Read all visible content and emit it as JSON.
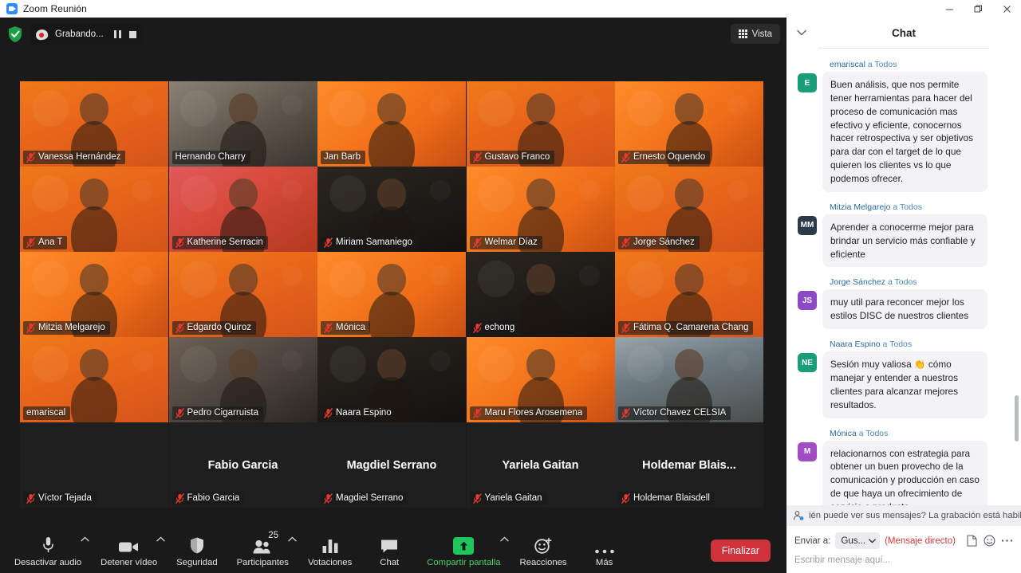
{
  "window": {
    "title": "Zoom Reunión",
    "logo_icon": "zoom-logo-icon",
    "minimize_icon": "minimize-icon",
    "maximize_icon": "restore-icon",
    "close_icon": "close-icon"
  },
  "recording": {
    "shield_icon": "security-shield-icon",
    "rec_icon": "recording-dot-icon",
    "label": "Grabando...",
    "pause_icon": "pause-icon",
    "stop_icon": "stop-icon"
  },
  "view_button": {
    "label": "Vista",
    "icon": "grid-view-icon"
  },
  "gallery": {
    "rows": [
      [
        {
          "name": "Vanessa Hernández",
          "muted": true,
          "speaking": false,
          "bg": "bg-orange",
          "kind": "video"
        },
        {
          "name": "Hernando Charry",
          "muted": false,
          "speaking": true,
          "bg": "bg-room",
          "kind": "video"
        },
        {
          "name": "Jan Barb",
          "muted": false,
          "speaking": false,
          "bg": "bg-orange2",
          "kind": "video"
        },
        {
          "name": "Gustavo Franco",
          "muted": true,
          "speaking": false,
          "bg": "bg-orange",
          "kind": "video"
        },
        {
          "name": "Ernesto Oquendo",
          "muted": true,
          "speaking": false,
          "bg": "bg-orange2",
          "kind": "video"
        }
      ],
      [
        {
          "name": "Ana T",
          "muted": true,
          "speaking": false,
          "bg": "bg-orange",
          "kind": "video"
        },
        {
          "name": "Katherine Serracin",
          "muted": true,
          "speaking": false,
          "bg": "bg-pinkish",
          "kind": "video"
        },
        {
          "name": "Miriam Samaniego",
          "muted": true,
          "speaking": false,
          "bg": "bg-dark",
          "kind": "video"
        },
        {
          "name": "Welmar Díaz",
          "muted": true,
          "speaking": false,
          "bg": "bg-orange2",
          "kind": "video"
        },
        {
          "name": "Jorge Sánchez",
          "muted": true,
          "speaking": false,
          "bg": "bg-orange",
          "kind": "video"
        }
      ],
      [
        {
          "name": "Mitzia Melgarejo",
          "muted": true,
          "speaking": false,
          "bg": "bg-orange2",
          "kind": "video"
        },
        {
          "name": "Edgardo Quiroz",
          "muted": true,
          "speaking": false,
          "bg": "bg-orange",
          "kind": "video"
        },
        {
          "name": "Mónica",
          "muted": true,
          "speaking": false,
          "bg": "bg-orange2",
          "kind": "video"
        },
        {
          "name": "echong",
          "muted": true,
          "speaking": false,
          "bg": "bg-dark",
          "kind": "video"
        },
        {
          "name": "Fátima Q. Camarena Chang",
          "muted": true,
          "speaking": false,
          "bg": "bg-orange",
          "kind": "video"
        }
      ],
      [
        {
          "name": "emariscal",
          "muted": false,
          "speaking": false,
          "bg": "bg-orange",
          "kind": "video"
        },
        {
          "name": "Pedro Cigarruista",
          "muted": true,
          "speaking": false,
          "bg": "bg-indoor",
          "kind": "video"
        },
        {
          "name": "Naara Espino",
          "muted": true,
          "speaking": false,
          "bg": "bg-dark",
          "kind": "video"
        },
        {
          "name": "Maru Flores Arosemena",
          "muted": true,
          "speaking": false,
          "bg": "bg-orange2",
          "kind": "video"
        },
        {
          "name": "Víctor Chavez  CELSIA",
          "muted": true,
          "speaking": false,
          "bg": "bg-outdoor",
          "kind": "video"
        }
      ],
      [
        {
          "name": "Víctor Tejada",
          "display": "",
          "muted": true,
          "speaking": false,
          "kind": "placeholder"
        },
        {
          "name": "Fabio Garcia",
          "display": "Fabio Garcia",
          "muted": true,
          "speaking": false,
          "kind": "placeholder"
        },
        {
          "name": "Magdiel Serrano",
          "display": "Magdiel Serrano",
          "muted": true,
          "speaking": false,
          "kind": "placeholder"
        },
        {
          "name": "Yariela Gaitan",
          "display": "Yariela Gaitan",
          "muted": true,
          "speaking": false,
          "kind": "placeholder"
        },
        {
          "name": "Holdemar Blaisdell",
          "display": "Holdemar  Blais...",
          "muted": true,
          "speaking": false,
          "kind": "placeholder"
        }
      ]
    ]
  },
  "chat": {
    "title": "Chat",
    "collapse_icon": "chevron-down-icon",
    "messages": [
      {
        "from": "emariscal",
        "to": "a Todos",
        "initials": "E",
        "color": "#1a9e77",
        "text": "Buen análisis, que nos permite tener herramientas para hacer del proceso de comunicación mas efectivo y eficiente, conocernos hacer retrospectiva y ser objetivos para dar con el target de lo que quieren los clientes vs lo que podemos ofrecer."
      },
      {
        "from": "Mitzia Melgarejo",
        "to": "a Todos",
        "initials": "MM",
        "color": "#2b3a4a",
        "text": "Aprender a conocerme mejor para brindar un servicio más confiable y eficiente"
      },
      {
        "from": "Jorge Sánchez",
        "to": "a Todos",
        "initials": "JS",
        "color": "#8a4bc4",
        "text": "muy util para reconcer mejor los estilos DISC de nuestros clientes"
      },
      {
        "from": "Naara Espino",
        "to": "a Todos",
        "initials": "NE",
        "color": "#1a9e77",
        "text": "Sesión muy valiosa 👏 cómo manejar y entender a nuestros clientes para alcanzar mejores resultados."
      },
      {
        "from": "Mónica",
        "to": "a Todos",
        "initials": "M",
        "color": "#a14bc4",
        "text": "relacionarnos con estrategia para obtener un buen provecho de la comunicación y producción en caso de que haya un ofrecimiento de servicio o producto"
      }
    ],
    "notice": {
      "icon": "person-privacy-icon",
      "text": "ién puede ver sus mensajes? La grabación está habilit"
    },
    "compose": {
      "send_to_label": "Enviar a:",
      "send_to_value": "Gus...",
      "chevron_icon": "chevron-down-icon",
      "direct_tag": "(Mensaje directo)",
      "file_icon": "file-icon",
      "emoji_icon": "emoji-icon",
      "more_icon": "more-dots-icon",
      "placeholder": "Escribir mensaje aquí..."
    }
  },
  "toolbar": {
    "items": [
      {
        "label": "Desactivar audio",
        "icon": "microphone-icon",
        "caret": true,
        "badge": "",
        "green": false
      },
      {
        "label": "Detener vídeo",
        "icon": "video-camera-icon",
        "caret": true,
        "badge": "",
        "green": false
      },
      {
        "label": "Seguridad",
        "icon": "shield-icon",
        "caret": false,
        "badge": "",
        "green": false
      },
      {
        "label": "Participantes",
        "icon": "participants-icon",
        "caret": true,
        "badge": "25",
        "green": false
      },
      {
        "label": "Votaciones",
        "icon": "polls-bar-icon",
        "caret": false,
        "badge": "",
        "green": false
      },
      {
        "label": "Chat",
        "icon": "chat-bubble-icon",
        "caret": false,
        "badge": "",
        "green": false
      },
      {
        "label": "Compartir pantalla",
        "icon": "share-screen-icon",
        "caret": true,
        "badge": "",
        "green": true
      },
      {
        "label": "Reacciones",
        "icon": "reactions-smiley-icon",
        "caret": false,
        "badge": "",
        "green": false
      },
      {
        "label": "Más",
        "icon": "more-dots-icon",
        "caret": false,
        "badge": "",
        "green": false
      }
    ],
    "end_button": {
      "label": "Finalizar",
      "color": "#d0323c"
    }
  }
}
